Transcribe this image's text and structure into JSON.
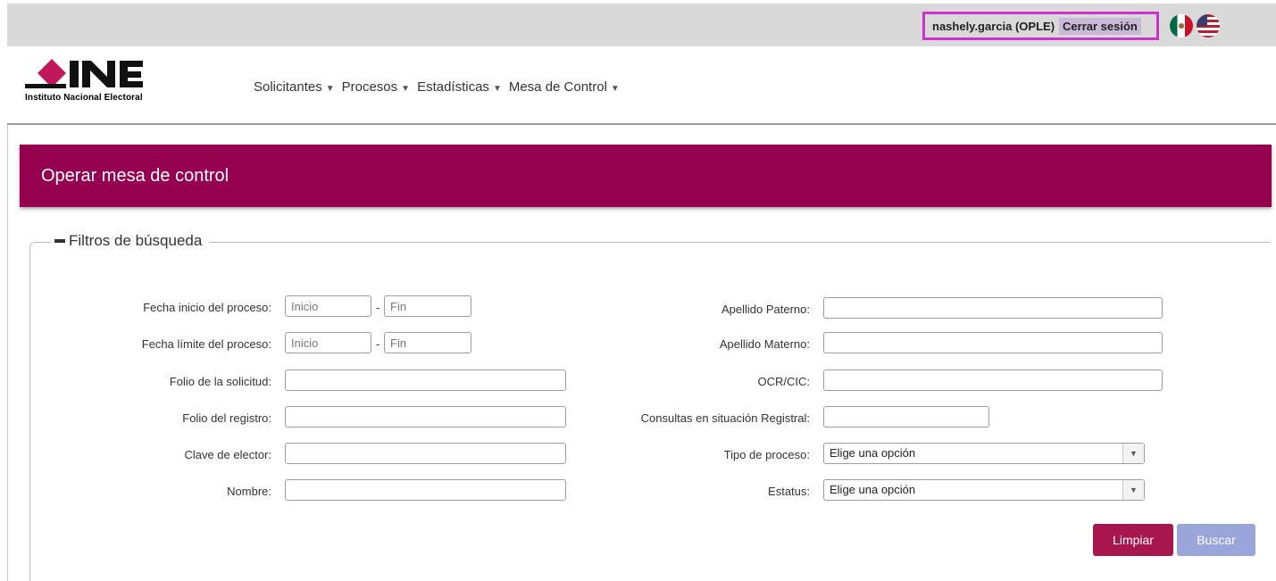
{
  "session": {
    "user": "nashely.garcia (OPLE)",
    "logout_label": "Cerrar sesión"
  },
  "brand": {
    "logo_word": "INE",
    "institution": "Instituto Nacional Electoral",
    "color": "#95004f"
  },
  "nav": [
    {
      "label": "Solicitantes"
    },
    {
      "label": "Procesos"
    },
    {
      "label": "Estadísticas"
    },
    {
      "label": "Mesa de Control"
    }
  ],
  "page_title": "Operar mesa de control",
  "filters": {
    "legend": "Filtros de búsqueda",
    "fecha_inicio": {
      "label": "Fecha inicio del proceso:",
      "start_placeholder": "Inicio",
      "end_placeholder": "Fin"
    },
    "fecha_limite": {
      "label": "Fecha límite del proceso:",
      "start_placeholder": "Inicio",
      "end_placeholder": "Fin"
    },
    "folio_solicitud": {
      "label": "Folio de la solicitud:",
      "value": ""
    },
    "folio_registro": {
      "label": "Folio del registro:",
      "value": ""
    },
    "clave_elector": {
      "label": "Clave de elector:",
      "value": ""
    },
    "nombre": {
      "label": "Nombre:",
      "value": ""
    },
    "apellido_paterno": {
      "label": "Apellido Paterno:",
      "value": ""
    },
    "apellido_materno": {
      "label": "Apellido Materno:",
      "value": ""
    },
    "ocr_cic": {
      "label": "OCR/CIC:",
      "value": ""
    },
    "consultas": {
      "label": "Consultas en situación Registral:",
      "value": ""
    },
    "tipo_proceso": {
      "label": "Tipo de proceso:",
      "selected": "Elige una opción"
    },
    "estatus": {
      "label": "Estatus:",
      "selected": "Elige una opción"
    },
    "range_separator": "-"
  },
  "actions": {
    "clear_label": "Limpiar",
    "search_label": "Buscar"
  }
}
